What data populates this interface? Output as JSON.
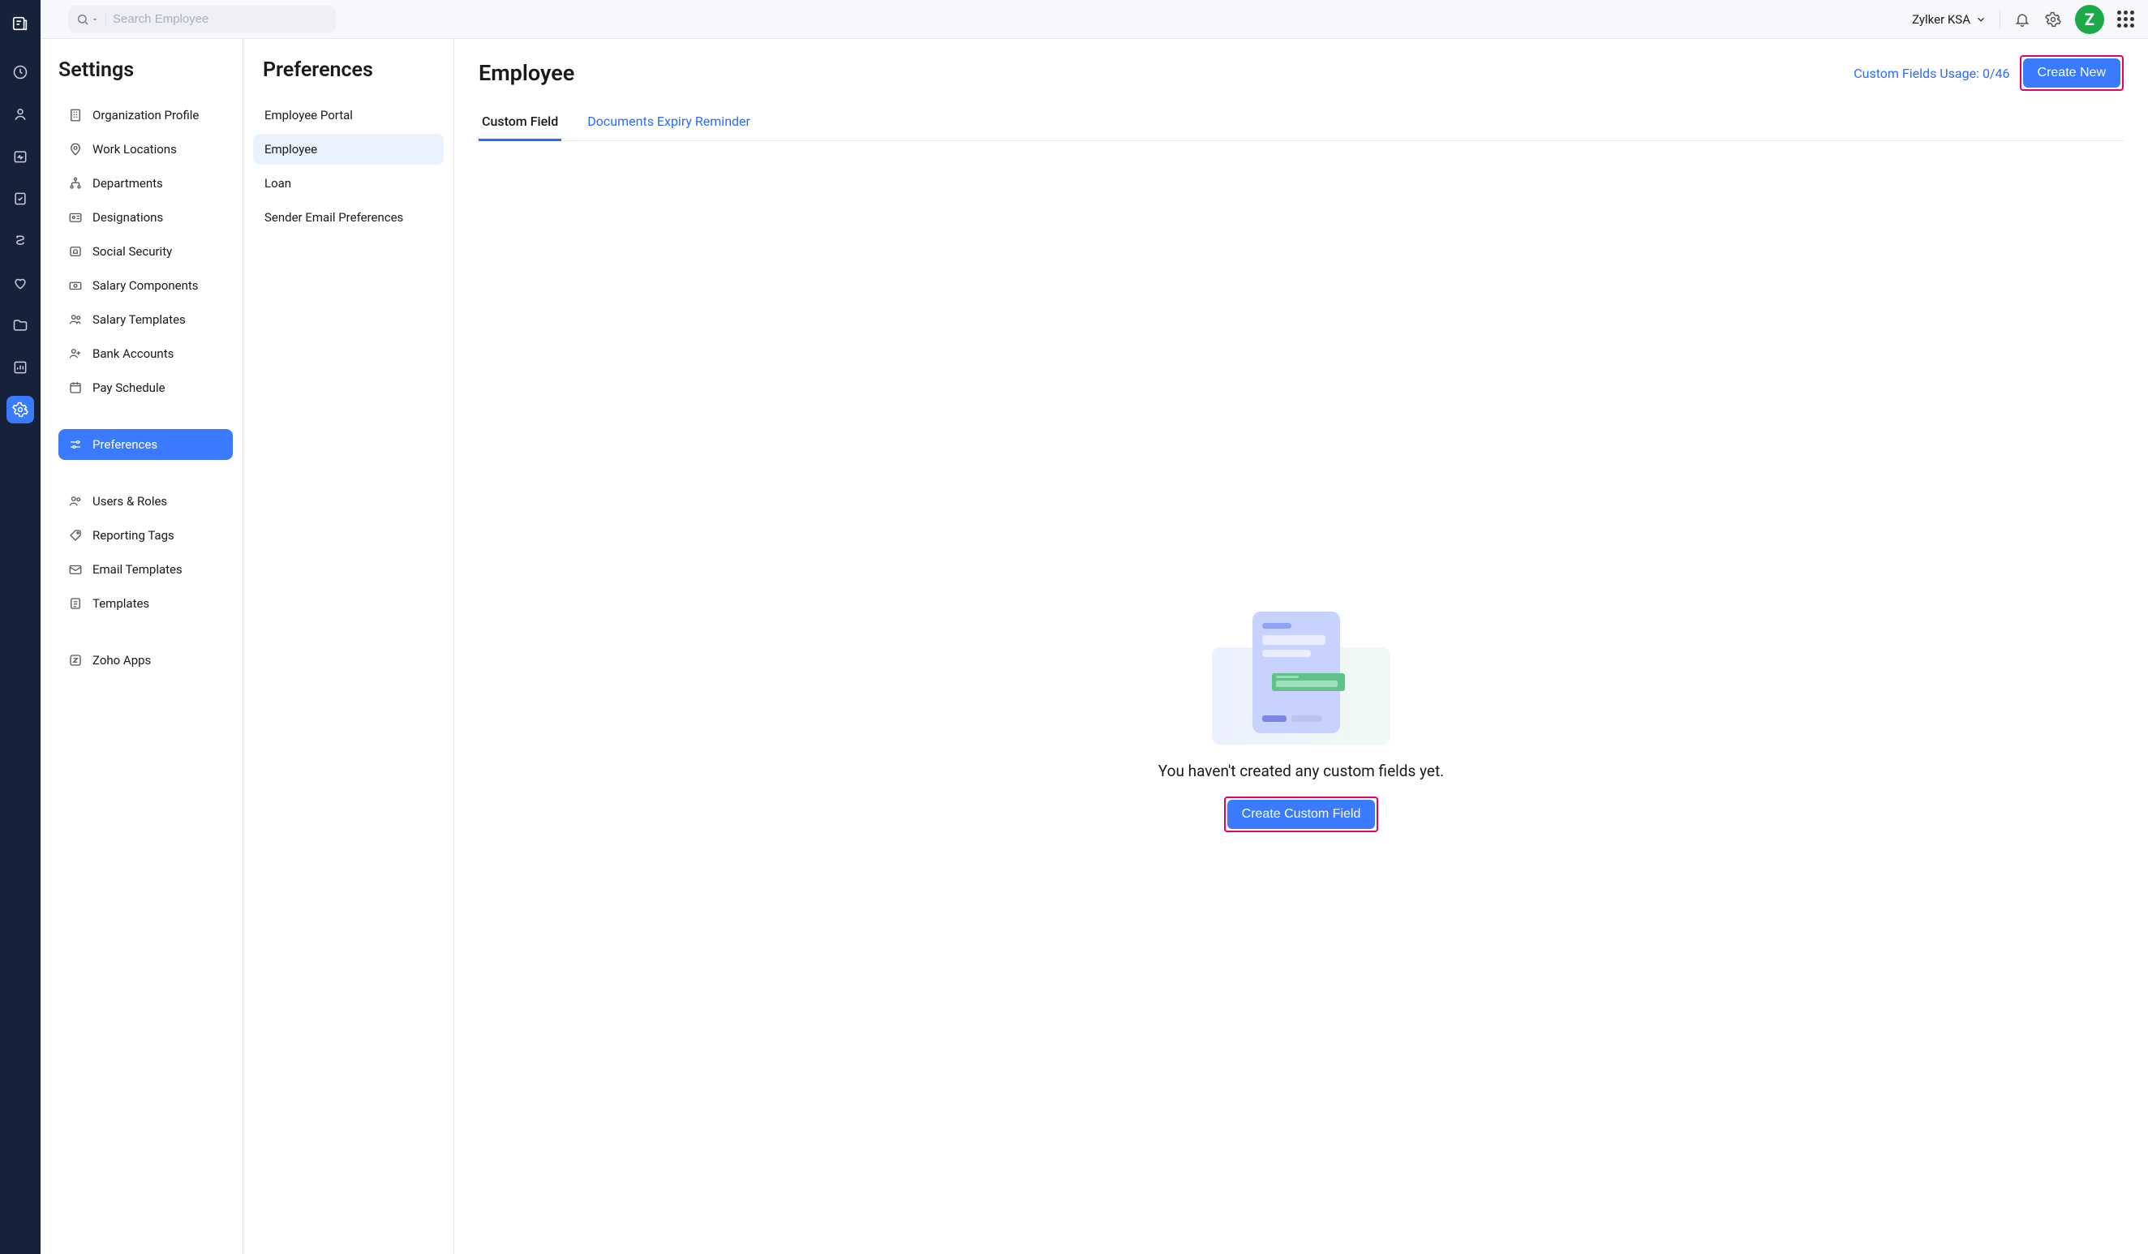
{
  "topbar": {
    "search_placeholder": "Search Employee",
    "org_name": "Zylker KSA",
    "avatar_letter": "Z"
  },
  "settings": {
    "title": "Settings",
    "items": [
      {
        "label": "Organization Profile"
      },
      {
        "label": "Work Locations"
      },
      {
        "label": "Departments"
      },
      {
        "label": "Designations"
      },
      {
        "label": "Social Security"
      },
      {
        "label": "Salary Components"
      },
      {
        "label": "Salary Templates"
      },
      {
        "label": "Bank Accounts"
      },
      {
        "label": "Pay Schedule"
      }
    ],
    "preferences_label": "Preferences",
    "items2": [
      {
        "label": "Users & Roles"
      },
      {
        "label": "Reporting Tags"
      },
      {
        "label": "Email Templates"
      },
      {
        "label": "Templates"
      }
    ],
    "items3": [
      {
        "label": "Zoho Apps"
      }
    ]
  },
  "prefs": {
    "title": "Preferences",
    "items": [
      {
        "label": "Employee Portal"
      },
      {
        "label": "Employee"
      },
      {
        "label": "Loan"
      },
      {
        "label": "Sender Email Preferences"
      }
    ]
  },
  "content": {
    "title": "Employee",
    "usage_text": "Custom Fields Usage: 0/46",
    "create_new_label": "Create New",
    "tabs": [
      {
        "label": "Custom Field"
      },
      {
        "label": "Documents Expiry Reminder"
      }
    ],
    "empty_text": "You haven't created any custom fields yet.",
    "empty_cta": "Create Custom Field"
  }
}
